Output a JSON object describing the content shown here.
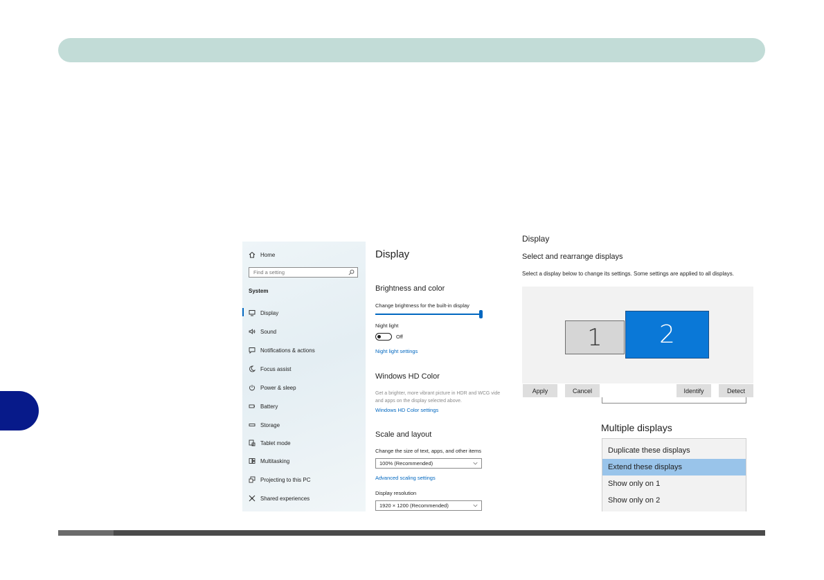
{
  "sidebar": {
    "home_label": "Home",
    "search_placeholder": "Find a setting",
    "section_label": "System",
    "items": [
      {
        "label": "Display",
        "icon": "monitor-icon"
      },
      {
        "label": "Sound",
        "icon": "speaker-icon"
      },
      {
        "label": "Notifications & actions",
        "icon": "notification-icon"
      },
      {
        "label": "Focus assist",
        "icon": "moon-icon"
      },
      {
        "label": "Power & sleep",
        "icon": "power-icon"
      },
      {
        "label": "Battery",
        "icon": "battery-icon"
      },
      {
        "label": "Storage",
        "icon": "storage-icon"
      },
      {
        "label": "Tablet mode",
        "icon": "tablet-icon"
      },
      {
        "label": "Multitasking",
        "icon": "multitasking-icon"
      },
      {
        "label": "Projecting to this PC",
        "icon": "projecting-icon"
      },
      {
        "label": "Shared experiences",
        "icon": "shared-icon"
      }
    ]
  },
  "settings": {
    "title": "Display",
    "brightness": {
      "heading": "Brightness and color",
      "slider_label": "Change brightness for the built-in display",
      "slider_value_percent": 100,
      "night_light_label": "Night light",
      "night_light_state": "Off",
      "night_light_link": "Night light settings"
    },
    "hdr": {
      "heading": "Windows HD Color",
      "description_line1": "Get a brighter, more vibrant picture in HDR and WCG vide",
      "description_line2": "and apps on the display selected above.",
      "link": "Windows HD Color settings"
    },
    "scale": {
      "heading": "Scale and layout",
      "size_label": "Change the size of text, apps, and other items",
      "size_value": "100% (Recommended)",
      "advanced_link": "Advanced scaling settings",
      "resolution_label": "Display resolution",
      "resolution_value": "1920 × 1200 (Recommended)"
    }
  },
  "arrange": {
    "cropped_title": "Display",
    "heading": "Select and rearrange displays",
    "description": "Select a display below to change its settings. Some settings are applied to all displays.",
    "monitors": [
      "1",
      "2"
    ],
    "selected_monitor": "2",
    "buttons": {
      "apply": "Apply",
      "cancel": "Cancel",
      "identify": "Identify",
      "detect": "Detect"
    }
  },
  "multiple_displays": {
    "heading": "Multiple displays",
    "options": [
      "Duplicate these displays",
      "Extend these displays",
      "Show only on 1",
      "Show only on 2"
    ],
    "selected": "Extend these displays"
  },
  "colors": {
    "header_bar": "#c2dcd7",
    "chapter_tab": "#071a8a",
    "accent": "#0067c0",
    "selected_monitor": "#0a78d7",
    "selected_option": "#99c4ea"
  }
}
